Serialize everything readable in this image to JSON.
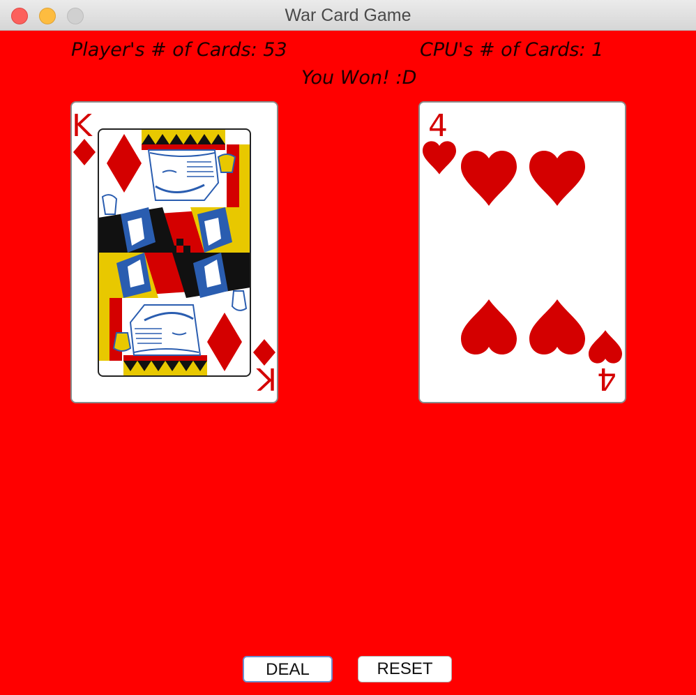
{
  "window": {
    "title": "War Card Game"
  },
  "status": {
    "player_count": "Player's # of Cards: 53",
    "cpu_count": "CPU's # of Cards: 1",
    "result": "You Won! :D"
  },
  "player_card": {
    "rank": "K",
    "suit": "diamonds",
    "suit_icon": "diamond-icon",
    "color": "#d40000"
  },
  "cpu_card": {
    "rank": "4",
    "suit": "hearts",
    "suit_icon": "heart-icon",
    "color": "#d40000"
  },
  "controls": {
    "deal_label": "DEAL",
    "reset_label": "RESET"
  },
  "colors": {
    "table_background": "#ff0000",
    "card_red": "#d40000"
  }
}
